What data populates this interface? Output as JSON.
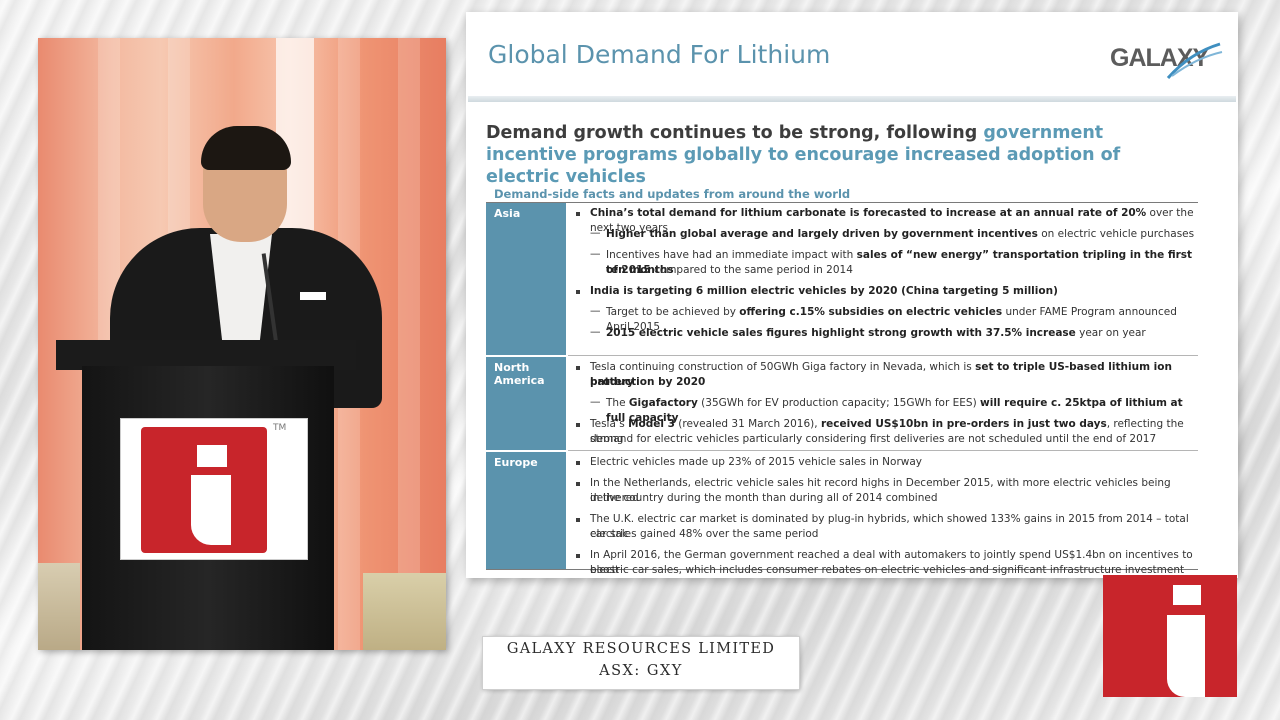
{
  "slide": {
    "title": "Global Demand For Lithium",
    "logo_text": "GALAXY",
    "headline_plain": "Demand growth continues to be strong, following ",
    "headline_highlight": "government incentive programs globally to encourage increased adoption of electric vehicles",
    "section_label": "Demand-side facts and updates from around the world",
    "regions": {
      "asia": "Asia",
      "north_america_1": "North",
      "north_america_2": "America",
      "europe": "Europe"
    },
    "asia": {
      "b1_bold": "China’s total demand for lithium carbonate is forecasted to increase at an annual rate of 20%",
      "b1_rest": " over the next two years",
      "d1_bold": "Higher than global average and largely driven by government incentives",
      "d1_rest": " on electric vehicle purchases",
      "d2_a": "Incentives have had an immediate impact with ",
      "d2_bold": "sales of “new energy” transportation tripling in the first ten months",
      "d2_line2_bold": "of 2015",
      "d2_line2_rest": " compared to the same period in 2014",
      "b2_bold": "India is targeting 6 million electric vehicles by 2020 (China targeting 5 million)",
      "d3_a": "Target to be achieved by ",
      "d3_bold": "offering c.15% subsidies on electric vehicles",
      "d3_rest": " under FAME Program announced April 2015",
      "d4_bold": "2015 electric vehicle sales figures highlight strong growth with 37.5% increase",
      "d4_rest": " year on year"
    },
    "north_america": {
      "b1_a": "Tesla continuing construction of 50GWh Giga factory in Nevada, which is ",
      "b1_bold": "set to triple US-based lithium ion battery",
      "b1_line2_bold": "production by 2020",
      "d1_a": "The ",
      "d1_bold1": "Gigafactory",
      "d1_mid": " (35GWh for EV production capacity; 15GWh for EES) ",
      "d1_bold2": "will require c. 25ktpa of lithium at full capacity",
      "b2_a": "Tesla’s ",
      "b2_bold1": "Model 3",
      "b2_mid": " (revealed 31 March 2016), ",
      "b2_bold2": "received US$10bn in pre-orders in just two days",
      "b2_rest": ", reflecting the strong",
      "b2_line2": "demand for electric vehicles particularly considering first deliveries are not scheduled until the end of 2017"
    },
    "europe": {
      "b1": "Electric vehicles made up 23% of 2015 vehicle sales in Norway",
      "b2_line1": "In the Netherlands, electric vehicle sales hit record highs in December 2015, with more electric vehicles being delivered",
      "b2_line2": "in the country during the month than during all of 2014 combined",
      "b3_line1": "The U.K. electric car market is dominated by plug-in hybrids, which showed 133% gains in 2015 from 2014 – total electric",
      "b3_line2": "car sales gained 48% over the same period",
      "b4_line1": "In April 2016, the German government reached a deal with automakers to jointly spend US$1.4bn on incentives to boost",
      "b4_line2": "electric car sales, which includes consumer rebates on electric vehicles and significant infrastructure investment"
    }
  },
  "caption": {
    "line1": "GALAXY RESOURCES LIMITED",
    "line2": "ASX: GXY"
  },
  "podium_tm": "TM",
  "colors": {
    "accent_blue": "#5b93ad",
    "brand_red": "#c8252b"
  }
}
